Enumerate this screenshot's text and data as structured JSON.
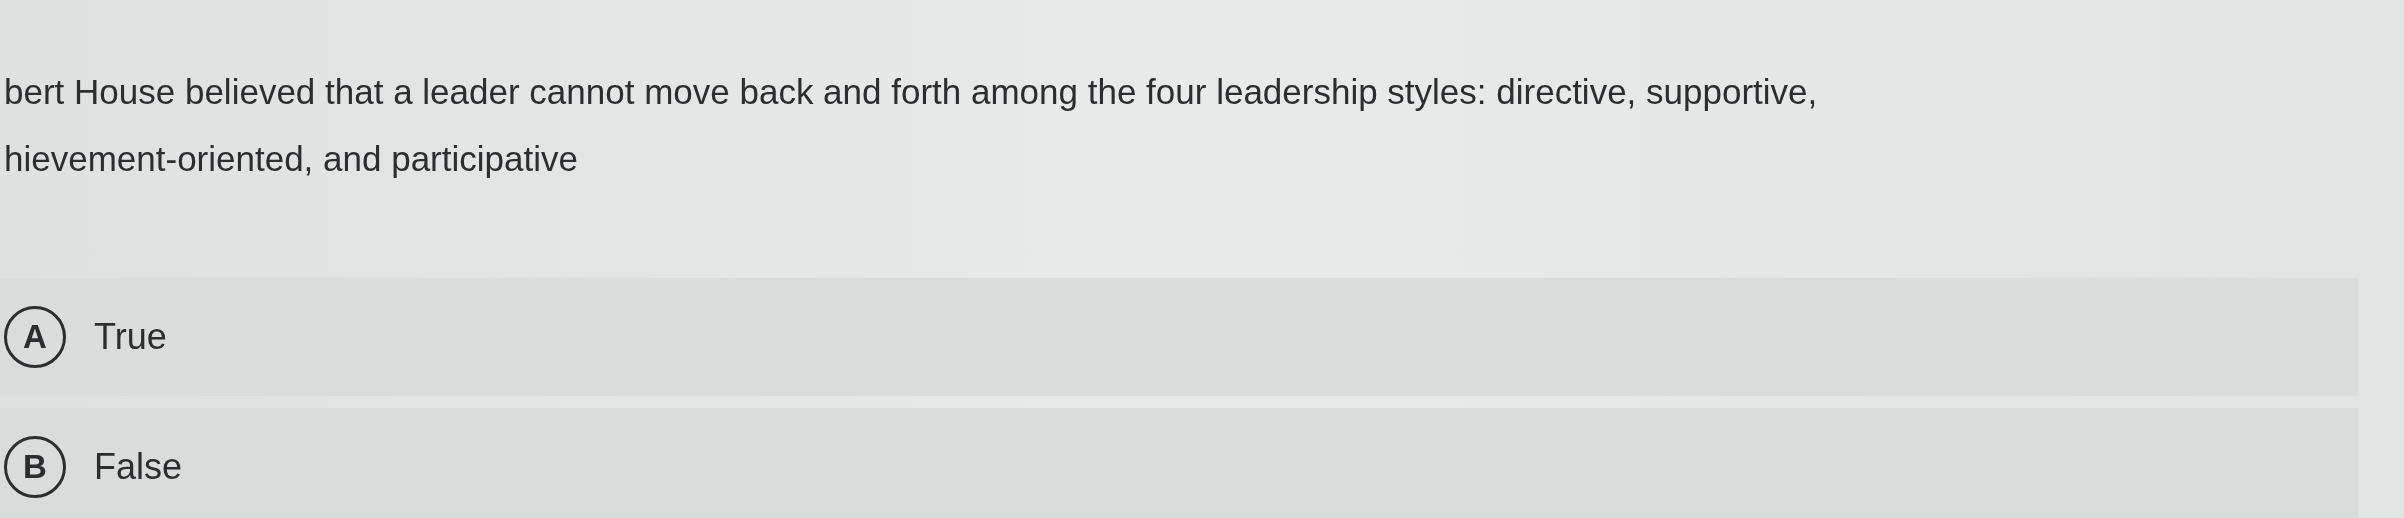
{
  "question": {
    "lines": [
      "bert House believed that a leader cannot move back and forth among the four leadership styles: directive, supportive,",
      "hievement-oriented, and participative"
    ]
  },
  "options": [
    {
      "letter": "A",
      "text": "True"
    },
    {
      "letter": "B",
      "text": "False"
    }
  ]
}
